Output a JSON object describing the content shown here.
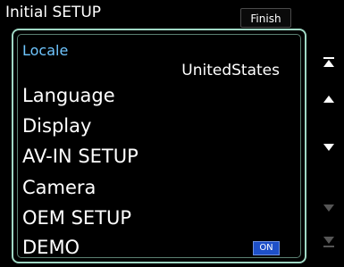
{
  "window": {
    "title": "Initial SETUP"
  },
  "toolbar": {
    "finish_label": "Finish"
  },
  "locale": {
    "label": "Locale",
    "value": "UnitedStates"
  },
  "items": [
    {
      "label": "Language"
    },
    {
      "label": "Display"
    },
    {
      "label": "AV-IN SETUP"
    },
    {
      "label": "Camera"
    },
    {
      "label": "OEM SETUP"
    },
    {
      "label": "DEMO"
    }
  ],
  "demo": {
    "toggle_label": "ON"
  },
  "scroll": {
    "icons": [
      "scroll-to-top-icon",
      "scroll-up-icon",
      "scroll-down-icon",
      "page-down-icon",
      "scroll-to-bottom-icon"
    ]
  },
  "colors": {
    "panel_border": "#9fd8c4",
    "locale_label": "#6fc6ff",
    "toggle_on": "#1e50c8"
  }
}
